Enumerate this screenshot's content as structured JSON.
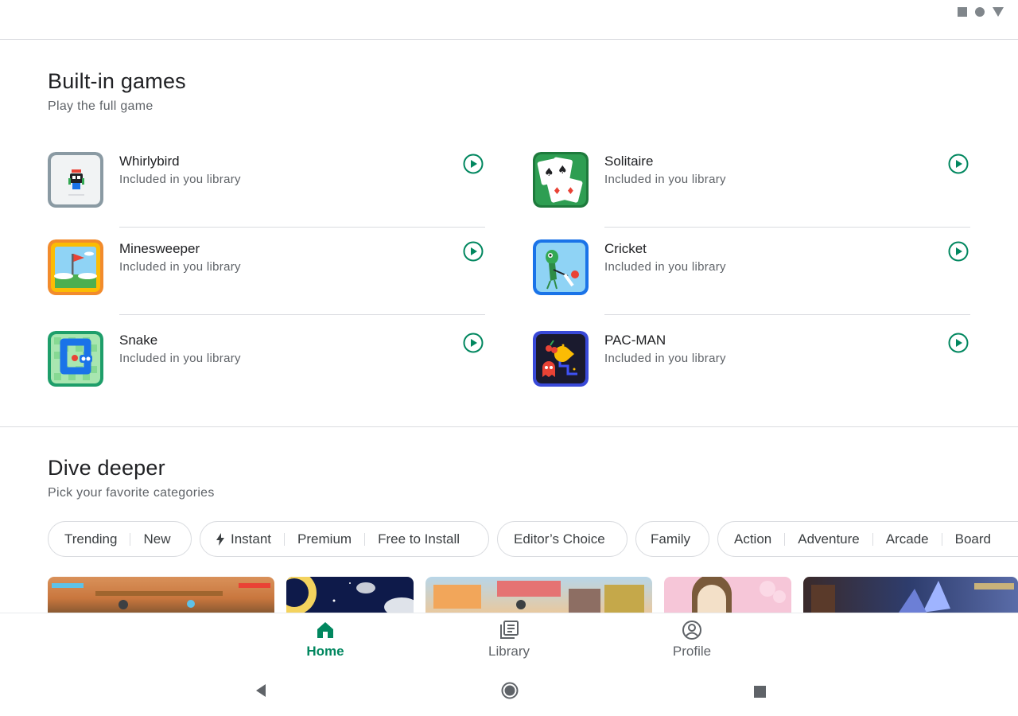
{
  "status_bar": {
    "icons": [
      "square-icon",
      "circle-icon",
      "triangle-icon"
    ]
  },
  "builtin": {
    "title": "Built-in games",
    "subtitle": "Play the full game",
    "games": [
      {
        "name": "Whirlybird",
        "subtitle": "Included in you library",
        "icon": "whirlybird-icon"
      },
      {
        "name": "Solitaire",
        "subtitle": "Included in you library",
        "icon": "solitaire-icon"
      },
      {
        "name": "Minesweeper",
        "subtitle": "Included in you library",
        "icon": "minesweeper-icon"
      },
      {
        "name": "Cricket",
        "subtitle": "Included in you library",
        "icon": "cricket-icon"
      },
      {
        "name": "Snake",
        "subtitle": "Included in you library",
        "icon": "snake-icon"
      },
      {
        "name": "PAC-MAN",
        "subtitle": "Included in you library",
        "icon": "pacman-icon"
      }
    ]
  },
  "dive": {
    "title": "Dive deeper",
    "subtitle": "Pick your favorite categories",
    "chips": {
      "group1": [
        "Trending",
        "New"
      ],
      "group2": [
        "Instant",
        "Premium",
        "Free to Install"
      ],
      "group3": [
        "Editor’s Choice"
      ],
      "group4": [
        "Family"
      ],
      "group5": [
        "Action",
        "Adventure",
        "Arcade",
        "Board"
      ]
    }
  },
  "nav": {
    "items": [
      {
        "label": "Home",
        "icon": "home-icon",
        "active": true
      },
      {
        "label": "Library",
        "icon": "library-icon",
        "active": false
      },
      {
        "label": "Profile",
        "icon": "profile-icon",
        "active": false
      }
    ]
  },
  "colors": {
    "accent": "#01875f",
    "divider": "#dadce0",
    "secondary_text": "#5f6368"
  }
}
